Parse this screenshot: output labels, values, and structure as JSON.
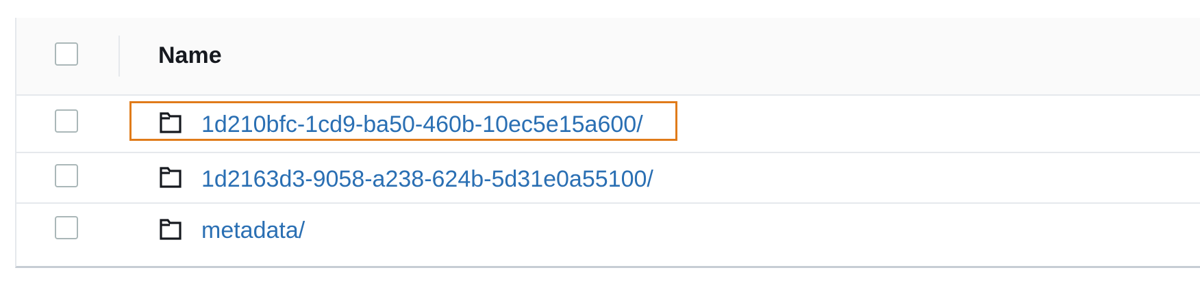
{
  "table": {
    "header": {
      "name_label": "Name"
    },
    "rows": [
      {
        "name": "1d210bfc-1cd9-ba50-460b-10ec5e15a600/",
        "icon": "folder-icon",
        "highlighted": true
      },
      {
        "name": "1d2163d3-9058-a238-624b-5d31e0a55100/",
        "icon": "folder-icon",
        "highlighted": false
      },
      {
        "name": "metadata/",
        "icon": "folder-icon",
        "highlighted": false
      }
    ]
  },
  "colors": {
    "link": "#2a6fb3",
    "highlight": "#e07b1a",
    "header_bg": "#fafafa",
    "border": "#e5e8ec"
  }
}
